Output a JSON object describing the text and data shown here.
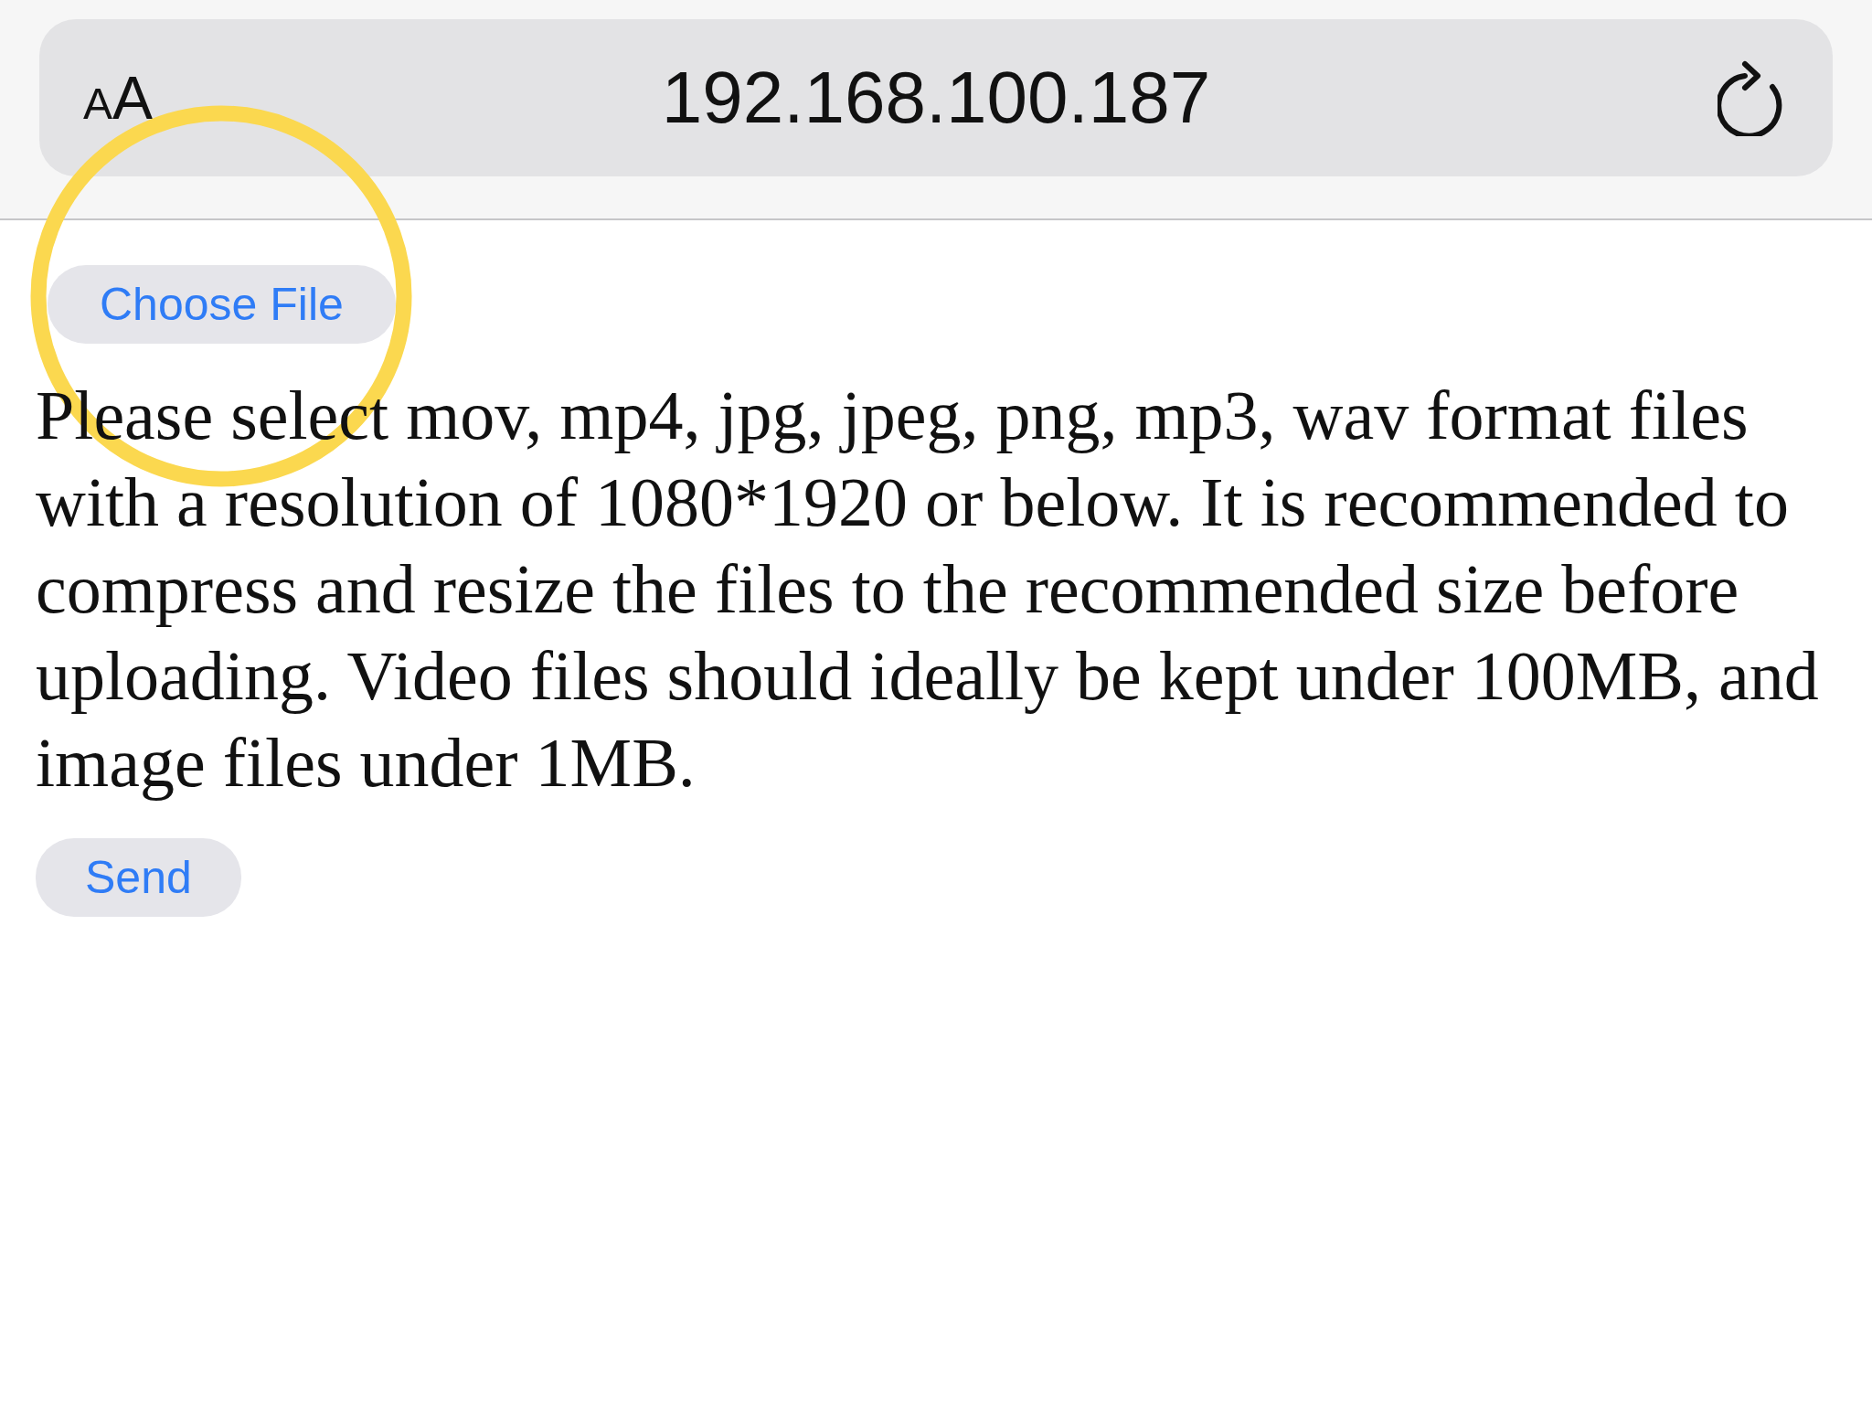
{
  "browser": {
    "format_button": "AA",
    "address": "192.168.100.187"
  },
  "page": {
    "file_button": "Choose File",
    "instructions": "Please select mov, mp4, jpg, jpeg, png, mp3, wav format files with a resolution of 1080*1920 or below. It is recommended to compress and resize the files to the recommended size before uploading. Video files should ideally be kept under 100MB, and image files under 1MB.",
    "send_button": "Send"
  }
}
